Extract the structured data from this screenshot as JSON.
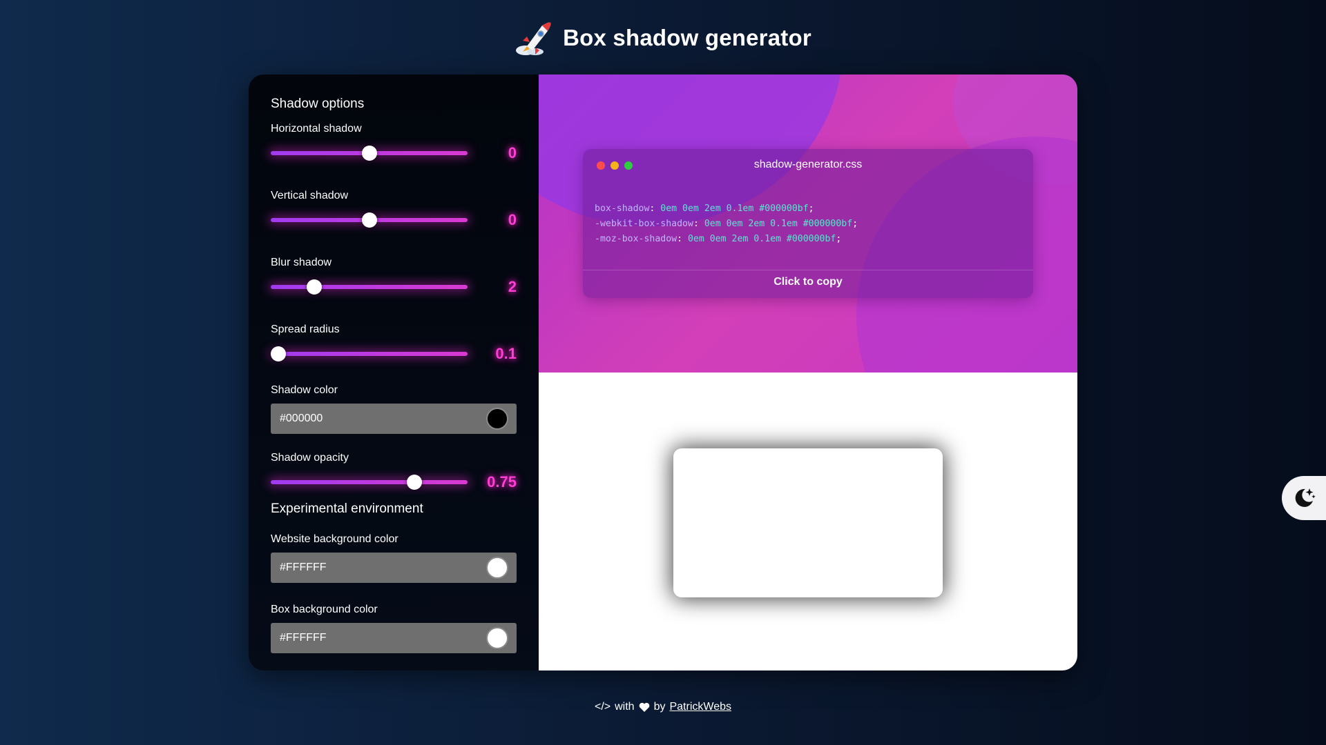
{
  "header": {
    "title": "Box shadow generator",
    "icon": "rocket-icon"
  },
  "sidebar": {
    "section_title": "Shadow options",
    "sliders": [
      {
        "label": "Horizontal shadow",
        "value": "0",
        "fraction": 0.5
      },
      {
        "label": "Vertical shadow",
        "value": "0",
        "fraction": 0.5
      },
      {
        "label": "Blur shadow",
        "value": "2",
        "fraction": 0.22
      },
      {
        "label": "Spread radius",
        "value": "0.1",
        "fraction": 0.04
      }
    ],
    "shadow_color": {
      "label": "Shadow color",
      "value": "#000000",
      "swatch": "#000000"
    },
    "opacity": {
      "label": "Shadow opacity",
      "value": "0.75",
      "fraction": 0.73
    },
    "env_title": "Experimental environment",
    "website_bg": {
      "label": "Website background color",
      "value": "#FFFFFF",
      "swatch": "#FFFFFF"
    },
    "box_bg": {
      "label": "Box background color",
      "value": "#FFFFFF",
      "swatch": "#FFFFFF"
    }
  },
  "code_card": {
    "title": "shadow-generator.css",
    "dots": [
      "#ff4d4d",
      "#f5b41b",
      "#2ecc40"
    ],
    "lines": [
      {
        "prop": "box-shadow",
        "val": "0em 0em 2em 0.1em #000000bf"
      },
      {
        "prop": "-webkit-box-shadow",
        "val": "0em 0em 2em 0.1em #000000bf"
      },
      {
        "prop": "-moz-box-shadow",
        "val": "0em 0em 2em 0.1em #000000bf"
      }
    ],
    "copy_label": "Click to copy"
  },
  "footer": {
    "code_glyph": "</>",
    "with": "with",
    "by": "by",
    "link": "PatrickWebs"
  },
  "colors": {
    "accent": "#d93ad1",
    "value_glow": "#ff3fd4"
  }
}
